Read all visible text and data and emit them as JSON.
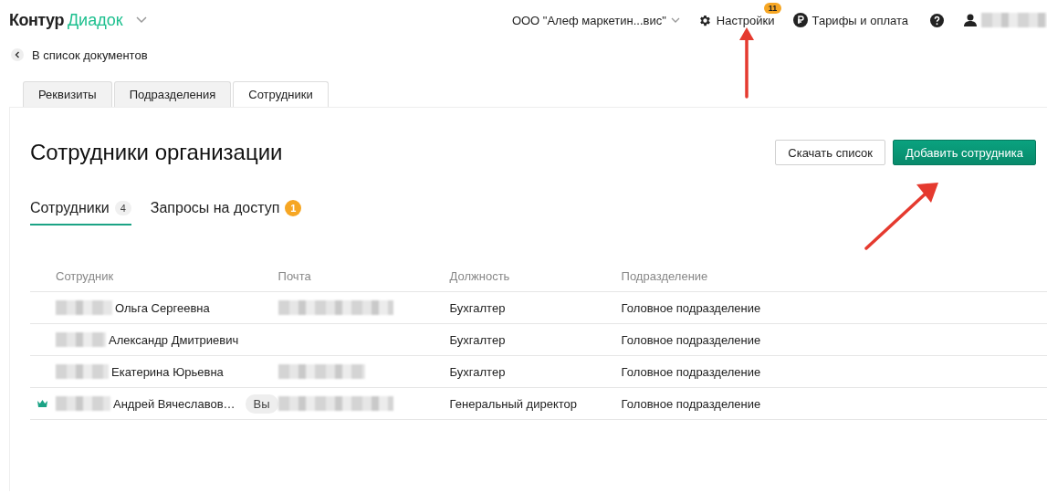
{
  "header": {
    "logo_left": "Контур",
    "logo_right": "Диадок",
    "organization": "ООО \"Алеф маркетин...вис\"",
    "settings": {
      "label": "Настройки",
      "badge": "11"
    },
    "billing": "Тарифы и оплата",
    "user_blurred": true
  },
  "back_link": "В список документов",
  "section_tabs": [
    {
      "label": "Реквизиты",
      "selected": false
    },
    {
      "label": "Подразделения",
      "selected": false
    },
    {
      "label": "Сотрудники",
      "selected": true
    }
  ],
  "page_title": "Сотрудники организации",
  "buttons": [
    {
      "label": "Скачать список",
      "kind": "secondary"
    },
    {
      "label": "Добавить сотрудника",
      "kind": "primary"
    }
  ],
  "tabs": [
    {
      "label": "Сотрудники",
      "count": "4",
      "selected": true,
      "kind": "count"
    },
    {
      "label": "Запросы на доступ",
      "count": "1",
      "selected": false,
      "kind": "alert"
    }
  ],
  "table": {
    "columns": [
      "Сотрудник",
      "Почта",
      "Должность",
      "Подразделение"
    ],
    "rows": [
      {
        "name": "Ольга Сергеевна",
        "owner": false,
        "email_blurred": true,
        "position": "Бухгалтер",
        "department": "Головное подразделение"
      },
      {
        "name": "Александр Дмитриевич",
        "owner": false,
        "email_blurred": false,
        "position": "Бухгалтер",
        "department": "Головное подразделение"
      },
      {
        "name": "Екатерина Юрьевна",
        "owner": false,
        "email_blurred": true,
        "position": "Бухгалтер",
        "department": "Головное подразделение"
      },
      {
        "name": "Андрей Вячеславов…",
        "owner": true,
        "you_badge": "Вы",
        "email_blurred": true,
        "position": "Генеральный директор",
        "department": "Головное подразделение"
      }
    ]
  },
  "annotations": [
    {
      "kind": "arrow"
    },
    {
      "kind": "arrow"
    }
  ]
}
